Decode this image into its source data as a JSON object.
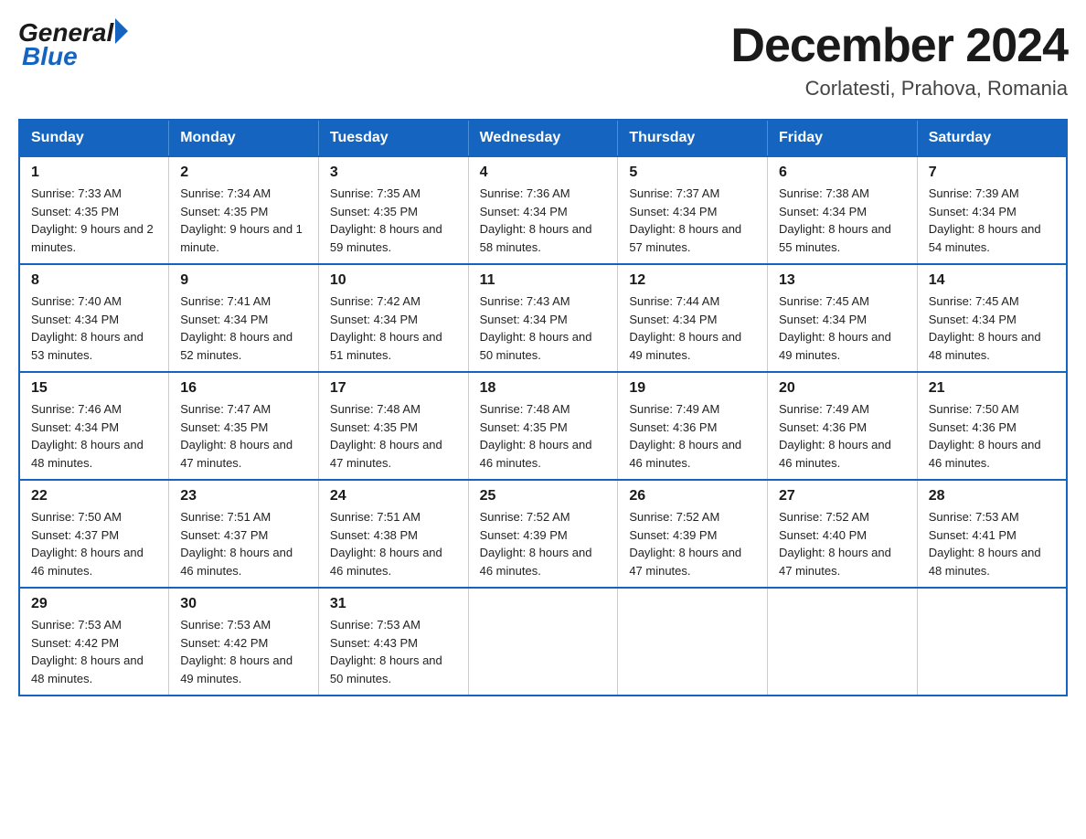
{
  "header": {
    "logo_general": "General",
    "logo_blue": "Blue",
    "month_title": "December 2024",
    "location": "Corlatesti, Prahova, Romania"
  },
  "days_of_week": [
    "Sunday",
    "Monday",
    "Tuesday",
    "Wednesday",
    "Thursday",
    "Friday",
    "Saturday"
  ],
  "weeks": [
    [
      {
        "day": "1",
        "sunrise": "7:33 AM",
        "sunset": "4:35 PM",
        "daylight": "9 hours and 2 minutes."
      },
      {
        "day": "2",
        "sunrise": "7:34 AM",
        "sunset": "4:35 PM",
        "daylight": "9 hours and 1 minute."
      },
      {
        "day": "3",
        "sunrise": "7:35 AM",
        "sunset": "4:35 PM",
        "daylight": "8 hours and 59 minutes."
      },
      {
        "day": "4",
        "sunrise": "7:36 AM",
        "sunset": "4:34 PM",
        "daylight": "8 hours and 58 minutes."
      },
      {
        "day": "5",
        "sunrise": "7:37 AM",
        "sunset": "4:34 PM",
        "daylight": "8 hours and 57 minutes."
      },
      {
        "day": "6",
        "sunrise": "7:38 AM",
        "sunset": "4:34 PM",
        "daylight": "8 hours and 55 minutes."
      },
      {
        "day": "7",
        "sunrise": "7:39 AM",
        "sunset": "4:34 PM",
        "daylight": "8 hours and 54 minutes."
      }
    ],
    [
      {
        "day": "8",
        "sunrise": "7:40 AM",
        "sunset": "4:34 PM",
        "daylight": "8 hours and 53 minutes."
      },
      {
        "day": "9",
        "sunrise": "7:41 AM",
        "sunset": "4:34 PM",
        "daylight": "8 hours and 52 minutes."
      },
      {
        "day": "10",
        "sunrise": "7:42 AM",
        "sunset": "4:34 PM",
        "daylight": "8 hours and 51 minutes."
      },
      {
        "day": "11",
        "sunrise": "7:43 AM",
        "sunset": "4:34 PM",
        "daylight": "8 hours and 50 minutes."
      },
      {
        "day": "12",
        "sunrise": "7:44 AM",
        "sunset": "4:34 PM",
        "daylight": "8 hours and 49 minutes."
      },
      {
        "day": "13",
        "sunrise": "7:45 AM",
        "sunset": "4:34 PM",
        "daylight": "8 hours and 49 minutes."
      },
      {
        "day": "14",
        "sunrise": "7:45 AM",
        "sunset": "4:34 PM",
        "daylight": "8 hours and 48 minutes."
      }
    ],
    [
      {
        "day": "15",
        "sunrise": "7:46 AM",
        "sunset": "4:34 PM",
        "daylight": "8 hours and 48 minutes."
      },
      {
        "day": "16",
        "sunrise": "7:47 AM",
        "sunset": "4:35 PM",
        "daylight": "8 hours and 47 minutes."
      },
      {
        "day": "17",
        "sunrise": "7:48 AM",
        "sunset": "4:35 PM",
        "daylight": "8 hours and 47 minutes."
      },
      {
        "day": "18",
        "sunrise": "7:48 AM",
        "sunset": "4:35 PM",
        "daylight": "8 hours and 46 minutes."
      },
      {
        "day": "19",
        "sunrise": "7:49 AM",
        "sunset": "4:36 PM",
        "daylight": "8 hours and 46 minutes."
      },
      {
        "day": "20",
        "sunrise": "7:49 AM",
        "sunset": "4:36 PM",
        "daylight": "8 hours and 46 minutes."
      },
      {
        "day": "21",
        "sunrise": "7:50 AM",
        "sunset": "4:36 PM",
        "daylight": "8 hours and 46 minutes."
      }
    ],
    [
      {
        "day": "22",
        "sunrise": "7:50 AM",
        "sunset": "4:37 PM",
        "daylight": "8 hours and 46 minutes."
      },
      {
        "day": "23",
        "sunrise": "7:51 AM",
        "sunset": "4:37 PM",
        "daylight": "8 hours and 46 minutes."
      },
      {
        "day": "24",
        "sunrise": "7:51 AM",
        "sunset": "4:38 PM",
        "daylight": "8 hours and 46 minutes."
      },
      {
        "day": "25",
        "sunrise": "7:52 AM",
        "sunset": "4:39 PM",
        "daylight": "8 hours and 46 minutes."
      },
      {
        "day": "26",
        "sunrise": "7:52 AM",
        "sunset": "4:39 PM",
        "daylight": "8 hours and 47 minutes."
      },
      {
        "day": "27",
        "sunrise": "7:52 AM",
        "sunset": "4:40 PM",
        "daylight": "8 hours and 47 minutes."
      },
      {
        "day": "28",
        "sunrise": "7:53 AM",
        "sunset": "4:41 PM",
        "daylight": "8 hours and 48 minutes."
      }
    ],
    [
      {
        "day": "29",
        "sunrise": "7:53 AM",
        "sunset": "4:42 PM",
        "daylight": "8 hours and 48 minutes."
      },
      {
        "day": "30",
        "sunrise": "7:53 AM",
        "sunset": "4:42 PM",
        "daylight": "8 hours and 49 minutes."
      },
      {
        "day": "31",
        "sunrise": "7:53 AM",
        "sunset": "4:43 PM",
        "daylight": "8 hours and 50 minutes."
      },
      null,
      null,
      null,
      null
    ]
  ]
}
